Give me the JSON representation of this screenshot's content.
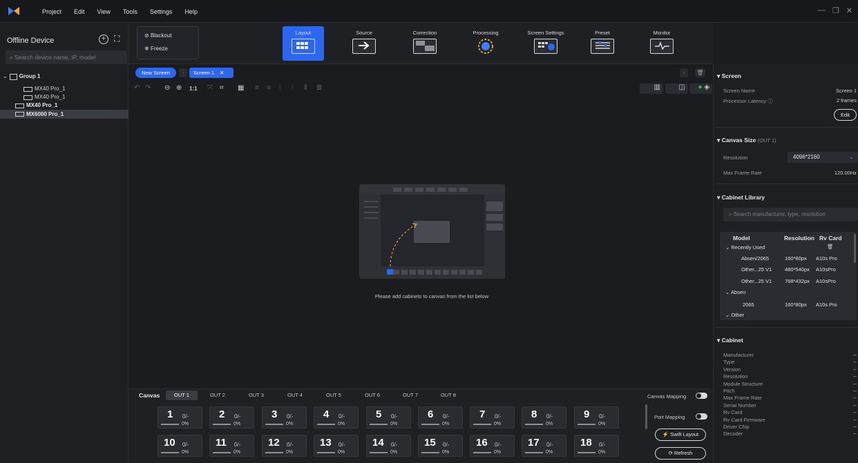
{
  "menu": {
    "items": [
      "Project",
      "Edit",
      "View",
      "Tools",
      "Settings",
      "Help"
    ],
    "window_controls": [
      "—",
      "❐",
      "✕"
    ]
  },
  "left_panel": {
    "title": "Offline Device",
    "search_placeholder": "Search device name, IP, model",
    "tree": [
      {
        "label": "Group 1",
        "level": 0,
        "bold": true,
        "group": true
      },
      {
        "label": "MX40 Pro_1",
        "level": 1,
        "bold": false
      },
      {
        "label": "MX40 Pro_1",
        "level": 1,
        "bold": false
      },
      {
        "label": "MX40 Pro_1",
        "level": 0,
        "bold": true
      },
      {
        "label": "MX6000 Pro_1",
        "level": 0,
        "bold": true,
        "selected": true
      }
    ]
  },
  "toolbar": {
    "blackout": "Blackout",
    "freeze": "Freeze",
    "tools": [
      {
        "label": "Layout",
        "icon": "layout-icon",
        "active": true
      },
      {
        "label": "Source",
        "icon": "source-icon",
        "active": false
      },
      {
        "label": "Correction",
        "icon": "correction-icon",
        "active": false
      },
      {
        "label": "Processing",
        "icon": "processing-icon",
        "active": false
      },
      {
        "label": "Screen Settings",
        "icon": "screen-settings-icon",
        "active": false
      },
      {
        "label": "Preset",
        "icon": "preset-icon",
        "active": false
      },
      {
        "label": "Monitor",
        "icon": "monitor-icon",
        "active": false
      }
    ]
  },
  "screen_tabs": {
    "new_screen": "New Screen",
    "screen": "Screen 1",
    "close": "✕"
  },
  "zoom_label": "1:1",
  "canvas": {
    "message": "Please add cabinets to canvas from the list below"
  },
  "outputs": {
    "canvas_label": "Canvas",
    "tabs": [
      "OUT 1",
      "OUT 2",
      "OUT 3",
      "OUT 4",
      "OUT 5",
      "OUT 6",
      "OUT 7",
      "OUT 8"
    ],
    "canvas_mapping": "Canvas Mapping",
    "port_mapping": "Port Mapping",
    "swift_layout": "Swift Layout",
    "refresh": "Refresh",
    "ports": [
      {
        "n": "1",
        "frac": "0/-",
        "pct": "0%"
      },
      {
        "n": "2",
        "frac": "0/-",
        "pct": "0%"
      },
      {
        "n": "3",
        "frac": "0/-",
        "pct": "0%"
      },
      {
        "n": "4",
        "frac": "0/-",
        "pct": "0%"
      },
      {
        "n": "5",
        "frac": "0/-",
        "pct": "0%"
      },
      {
        "n": "6",
        "frac": "0/-",
        "pct": "0%"
      },
      {
        "n": "7",
        "frac": "0/-",
        "pct": "0%"
      },
      {
        "n": "8",
        "frac": "0/-",
        "pct": "0%"
      },
      {
        "n": "9",
        "frac": "0/-",
        "pct": "0%"
      },
      {
        "n": "10",
        "frac": "0/-",
        "pct": "0%"
      },
      {
        "n": "11",
        "frac": "0/-",
        "pct": "0%"
      },
      {
        "n": "12",
        "frac": "0/-",
        "pct": "0%"
      },
      {
        "n": "13",
        "frac": "0/-",
        "pct": "0%"
      },
      {
        "n": "14",
        "frac": "0/-",
        "pct": "0%"
      },
      {
        "n": "15",
        "frac": "0/-",
        "pct": "0%"
      },
      {
        "n": "16",
        "frac": "0/-",
        "pct": "0%"
      },
      {
        "n": "17",
        "frac": "0/-",
        "pct": "0%"
      },
      {
        "n": "18",
        "frac": "0/-",
        "pct": "0%"
      }
    ]
  },
  "right_panel": {
    "screen": {
      "title": "Screen",
      "name_label": "Screen Name",
      "name_value": "Screen 1",
      "latency_label": "Processor Latency",
      "latency_value": "2 frames",
      "edit": "Edit"
    },
    "canvas_size": {
      "title": "Canvas Size",
      "suffix": "(OUT 1)",
      "resolution_label": "Resolution",
      "resolution_value": "4096*2160",
      "frame_rate_label": "Max Frame Rate",
      "frame_rate_value": "120.00Hz"
    },
    "library": {
      "title": "Cabinet Library",
      "search_placeholder": "Search manufacturer, type, resolution",
      "headers": [
        "Model",
        "Resolution",
        "Rv Card"
      ],
      "groups": [
        "Recently Used",
        "Absen",
        "Other"
      ],
      "rows": [
        {
          "model": "Absen/2065",
          "res": "160*80px",
          "card": "A10s Pro"
        },
        {
          "model": "Other...25 V1",
          "res": "480*540px",
          "card": "A10sPro"
        },
        {
          "model": "Other...25 V1",
          "res": "768*432px",
          "card": "A10sPro"
        },
        {
          "model": "2065",
          "res": "160*80px",
          "card": "A10s Pro"
        }
      ]
    },
    "cabinet": {
      "title": "Cabinet",
      "fields": [
        "Manufacturer",
        "Type",
        "Version",
        "Resolution",
        "Module Structure",
        "Pitch",
        "Max Frame Rate",
        "Serial Number",
        "Rv Card",
        "Rv Card Firmware",
        "Driver Chip",
        "Decoder"
      ],
      "value": "--"
    }
  }
}
